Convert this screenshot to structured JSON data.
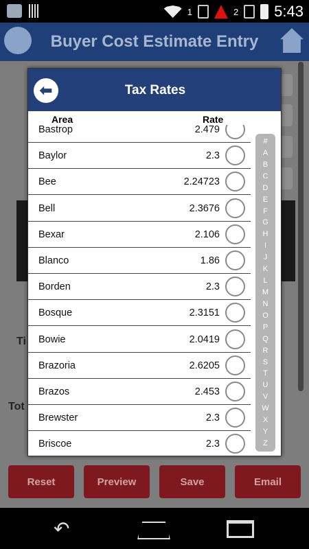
{
  "status_bar": {
    "time": "5:43",
    "sim1_label": "1",
    "sim2_label": "2"
  },
  "app": {
    "title": "Buyer Cost Estimate Entry",
    "partial_label_1": "Ti",
    "partial_label_2": "Tot",
    "buttons": [
      {
        "label": "Reset"
      },
      {
        "label": "Preview"
      },
      {
        "label": "Save"
      },
      {
        "label": "Email"
      }
    ]
  },
  "dialog": {
    "title": "Tax Rates",
    "col_area": "Area",
    "col_rate": "Rate",
    "rows": [
      {
        "area": "Bastrop",
        "rate": "2.479"
      },
      {
        "area": "Baylor",
        "rate": "2.3"
      },
      {
        "area": "Bee",
        "rate": "2.24723"
      },
      {
        "area": "Bell",
        "rate": "2.3676"
      },
      {
        "area": "Bexar",
        "rate": "2.106"
      },
      {
        "area": "Blanco",
        "rate": "1.86"
      },
      {
        "area": "Borden",
        "rate": "2.3"
      },
      {
        "area": "Bosque",
        "rate": "2.3151"
      },
      {
        "area": "Bowie",
        "rate": "2.0419"
      },
      {
        "area": "Brazoria",
        "rate": "2.6205"
      },
      {
        "area": "Brazos",
        "rate": "2.453"
      },
      {
        "area": "Brewster",
        "rate": "2.3"
      },
      {
        "area": "Briscoe",
        "rate": "2.3"
      }
    ],
    "alphabet": [
      "#",
      "A",
      "B",
      "C",
      "D",
      "E",
      "F",
      "G",
      "H",
      "I",
      "J",
      "K",
      "L",
      "M",
      "N",
      "O",
      "P",
      "Q",
      "R",
      "S",
      "T",
      "U",
      "V",
      "W",
      "X",
      "Y",
      "Z"
    ]
  }
}
